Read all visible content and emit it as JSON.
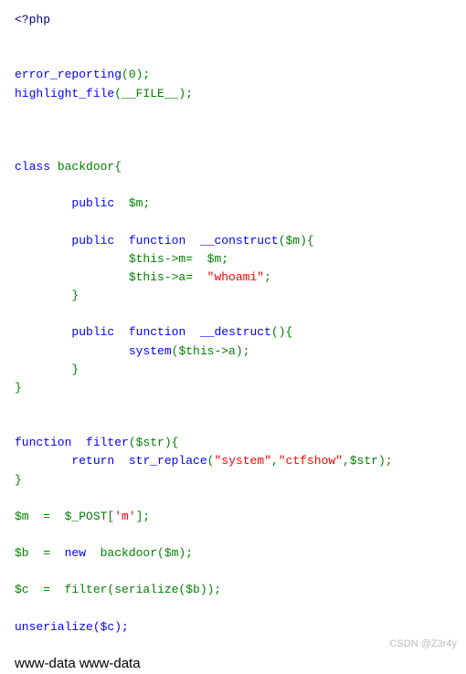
{
  "code": {
    "open_tag": "<?php",
    "l_err_rep_fn": "error_reporting",
    "l_err_rep_args": "(0);",
    "l_hl_fn": "highlight_file",
    "l_hl_args": "(__FILE__);",
    "kw_class": "class",
    "cls_name": " backdoor{",
    "kw_public": "public",
    "prop_m": "$m;",
    "kw_function": "function",
    "fn_construct": "__construct",
    "construct_args": "($m){",
    "assign_m": "$this->m=  $m;",
    "assign_a_pre": "$this->a=  ",
    "str_whoami": "\"whoami\"",
    "semi": ";",
    "brace_close": "}",
    "fn_destruct": "__destruct",
    "destruct_args": "(){",
    "call_system": "system",
    "system_args": "($this->a);",
    "fn_filter": "filter",
    "filter_args": "($str){",
    "kw_return": "return",
    "fn_strrep": "str_replace",
    "paren_open": "(",
    "str_system": "\"system\"",
    "comma": ",",
    "str_ctfshow": "\"ctfshow\"",
    "strrep_tail": ",$str);",
    "l_m_assign_pre": "$m  =  $_POST[",
    "str_m": "'m'",
    "l_m_assign_post": "];",
    "l_b_a": "$b  =  ",
    "kw_new": "new",
    "l_b_b": "  backdoor($m);",
    "l_c": "$c  =  filter(serialize($b));",
    "l_unser": "unserialize($c);"
  },
  "output": "www-data www-data",
  "watermark": "CSDN @Z3r4y"
}
